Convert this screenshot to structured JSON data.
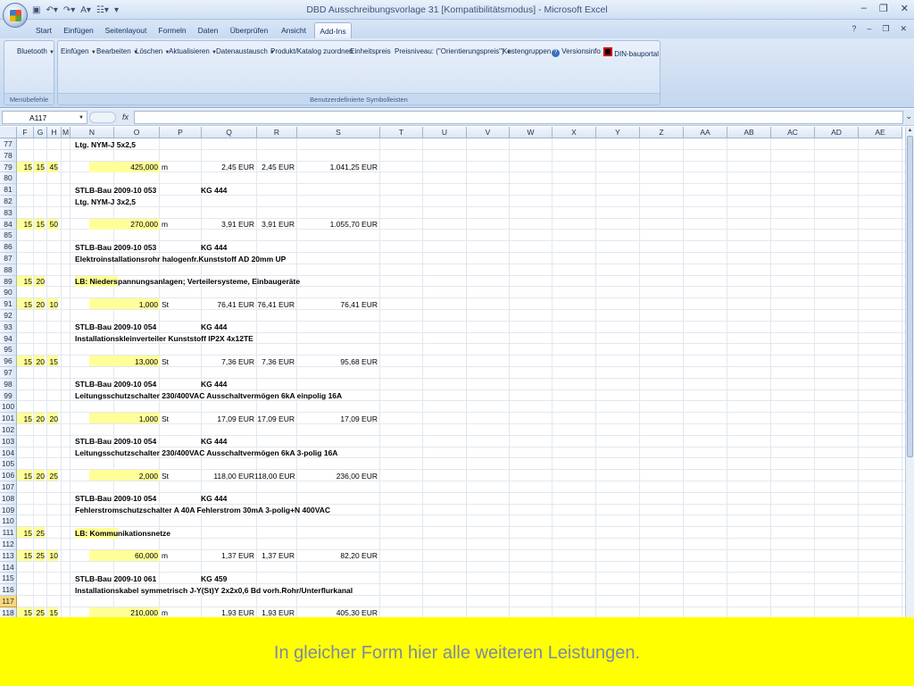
{
  "window": {
    "title": "DBD Ausschreibungsvorlage 31  [Kompatibilitätsmodus] - Microsoft Excel"
  },
  "tabs": [
    {
      "label": "Start"
    },
    {
      "label": "Einfügen"
    },
    {
      "label": "Seitenlayout"
    },
    {
      "label": "Formeln"
    },
    {
      "label": "Daten"
    },
    {
      "label": "Überprüfen"
    },
    {
      "label": "Ansicht"
    },
    {
      "label": "Add-Ins"
    }
  ],
  "active_tab": "Add-Ins",
  "ribbon": {
    "group_menu": {
      "label": "Menübefehle",
      "items": [
        "Bluetooth"
      ]
    },
    "group_toolbars": {
      "label": "Benutzerdefinierte Symbolleisten",
      "items": [
        "Einfügen",
        "Bearbeiten",
        "Löschen",
        "Aktualisieren",
        "Datenaustausch",
        "Produkt/Katalog zuordnen",
        "Einheitspreis",
        "Preisniveau: (\"Orientierungspreis\")",
        "Kostengruppen",
        "Versionsinfo",
        "DIN-bauportal"
      ]
    }
  },
  "formula_bar": {
    "name_box": "A117",
    "fx": "fx",
    "value": ""
  },
  "columns": [
    "F",
    "G",
    "H",
    "M",
    "N",
    "O",
    "P",
    "Q",
    "R",
    "S",
    "T",
    "U",
    "V",
    "W",
    "X",
    "Y",
    "Z",
    "AA",
    "AB",
    "AC",
    "AD",
    "AE"
  ],
  "rows": [
    "77",
    "78",
    "79",
    "80",
    "81",
    "82",
    "83",
    "84",
    "85",
    "86",
    "87",
    "88",
    "89",
    "90",
    "91",
    "92",
    "93",
    "94",
    "95",
    "96",
    "97",
    "98",
    "99",
    "100",
    "101",
    "102",
    "103",
    "104",
    "105",
    "106",
    "107",
    "108",
    "109",
    "110",
    "111",
    "112",
    "113",
    "114",
    "115",
    "116",
    "117",
    "118"
  ],
  "selected_row": "117",
  "cells": {
    "r77": {
      "n": "Ltg. NYM-J 5x2,5"
    },
    "r79": {
      "f": "15",
      "g": "15",
      "h": "45",
      "o": "425,000",
      "p": "m",
      "q": "2,45 EUR",
      "rr": "2,45 EUR",
      "s": "1.041,25 EUR"
    },
    "r81": {
      "n": "STLB-Bau 2009-10 053",
      "kg": "KG  444"
    },
    "r82": {
      "n": "Ltg. NYM-J 3x2,5"
    },
    "r84": {
      "f": "15",
      "g": "15",
      "h": "50",
      "o": "270,000",
      "p": "m",
      "q": "3,91 EUR",
      "rr": "3,91 EUR",
      "s": "1.055,70 EUR"
    },
    "r86": {
      "n": "STLB-Bau 2009-10 053",
      "kg": "KG  444"
    },
    "r87": {
      "n": "Elektroinstallationsrohr halogenfr.Kunststoff AD 20mm UP"
    },
    "r89": {
      "f": "15",
      "g": "20",
      "n_hl": "LB: Nieders",
      "n_rest": "pannungsanlagen; Verteilersysteme, Einbaugeräte"
    },
    "r91": {
      "f": "15",
      "g": "20",
      "h": "10",
      "o": "1,000",
      "p": "St",
      "q": "76,41 EUR",
      "rr": "76,41 EUR",
      "s": "76,41 EUR"
    },
    "r93": {
      "n": "STLB-Bau 2009-10 054",
      "kg": "KG  444"
    },
    "r94": {
      "n": "Installationskleinverteiler Kunststoff IP2X 4x12TE"
    },
    "r96": {
      "f": "15",
      "g": "20",
      "h": "15",
      "o": "13,000",
      "p": "St",
      "q": "7,36 EUR",
      "rr": "7,36 EUR",
      "s": "95,68 EUR"
    },
    "r98": {
      "n": "STLB-Bau 2009-10 054",
      "kg": "KG  444"
    },
    "r99": {
      "n": "Leitungsschutzschalter 230/400VAC Ausschaltvermögen 6kA einpolig 16A"
    },
    "r101": {
      "f": "15",
      "g": "20",
      "h": "20",
      "o": "1,000",
      "p": "St",
      "q": "17,09 EUR",
      "rr": "17,09 EUR",
      "s": "17,09 EUR"
    },
    "r103": {
      "n": "STLB-Bau 2009-10 054",
      "kg": "KG  444"
    },
    "r104": {
      "n": "Leitungsschutzschalter 230/400VAC Ausschaltvermögen 6kA 3-polig 16A"
    },
    "r106": {
      "f": "15",
      "g": "20",
      "h": "25",
      "o": "2,000",
      "p": "St",
      "q": "118,00 EUR",
      "rr": "118,00 EUR",
      "s": "236,00 EUR"
    },
    "r108": {
      "n": "STLB-Bau 2009-10 054",
      "kg": "KG  444"
    },
    "r109": {
      "n": "Fehlerstromschutzschalter A 40A Fehlerstrom 30mA 3-polig+N 400VAC"
    },
    "r111": {
      "f": "15",
      "g": "25",
      "n_hl": "LB: Kommu",
      "n_rest": "nikationsnetze"
    },
    "r113": {
      "f": "15",
      "g": "25",
      "h": "10",
      "o": "60,000",
      "p": "m",
      "q": "1,37 EUR",
      "rr": "1,37 EUR",
      "s": "82,20 EUR"
    },
    "r115": {
      "n": "STLB-Bau 2009-10 061",
      "kg": "KG  459"
    },
    "r116": {
      "n": "Installationskabel symmetrisch J-Y(St)Y 2x2x0,6 Bd vorh.Rohr/Unterflurkanal"
    },
    "r118": {
      "f": "15",
      "g": "25",
      "h": "15",
      "o": "210,000",
      "p": "m",
      "q": "1,93 EUR",
      "rr": "1,93 EUR",
      "s": "405,30 EUR"
    }
  },
  "banner": {
    "text": "In gleicher Form hier alle weiteren Leistungen.",
    "color": "#ffff00"
  }
}
